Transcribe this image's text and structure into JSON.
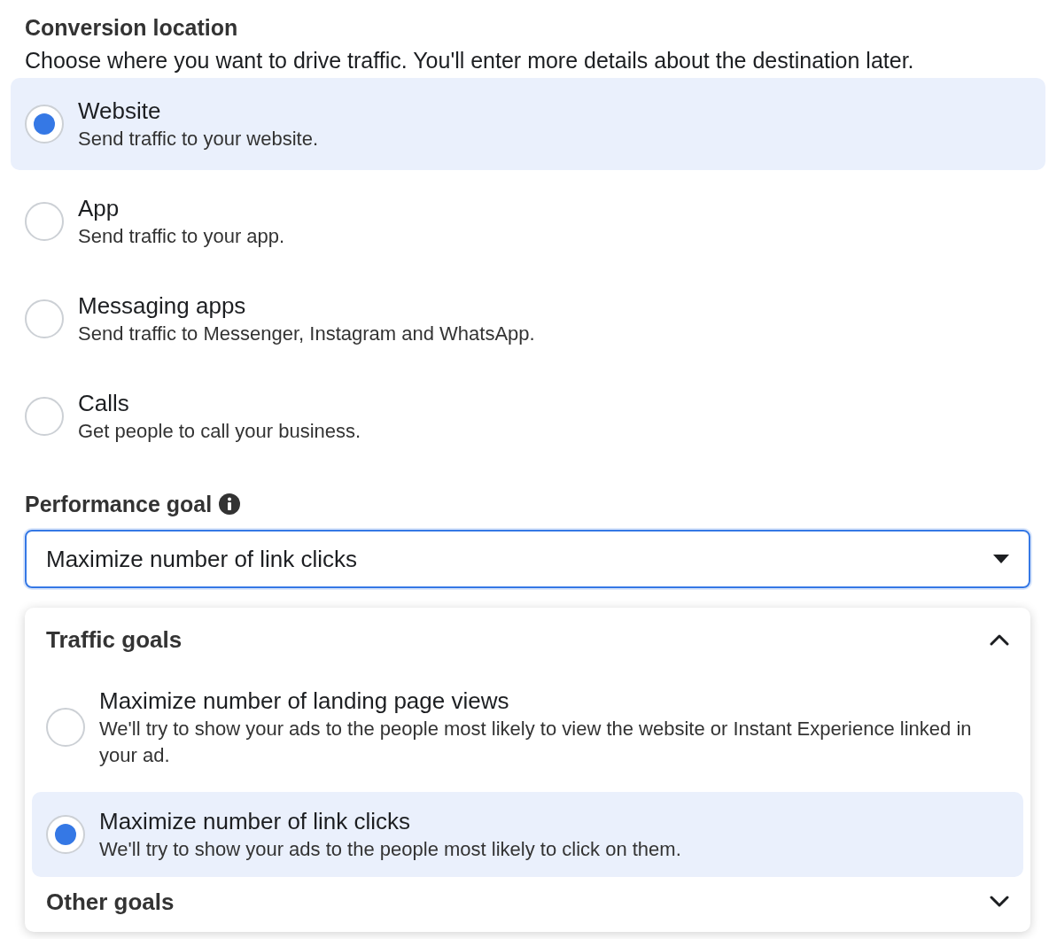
{
  "conversion_location": {
    "title": "Conversion location",
    "description": "Choose where you want to drive traffic. You'll enter more details about the destination later.",
    "options": [
      {
        "label": "Website",
        "description": "Send traffic to your website.",
        "selected": true
      },
      {
        "label": "App",
        "description": "Send traffic to your app.",
        "selected": false
      },
      {
        "label": "Messaging apps",
        "description": "Send traffic to Messenger, Instagram and WhatsApp.",
        "selected": false
      },
      {
        "label": "Calls",
        "description": "Get people to call your business.",
        "selected": false
      }
    ]
  },
  "performance_goal": {
    "title": "Performance goal",
    "value": "Maximize number of link clicks",
    "expanded": true,
    "groups": [
      {
        "title": "Traffic goals",
        "expanded": true,
        "options": [
          {
            "label": "Maximize number of landing page views",
            "description": "We'll try to show your ads to the people most likely to view the website or Instant Experience linked in your ad.",
            "selected": false
          },
          {
            "label": "Maximize number of link clicks",
            "description": "We'll try to show your ads to the people most likely to click on them.",
            "selected": true
          }
        ]
      },
      {
        "title": "Other goals",
        "expanded": false
      }
    ]
  }
}
